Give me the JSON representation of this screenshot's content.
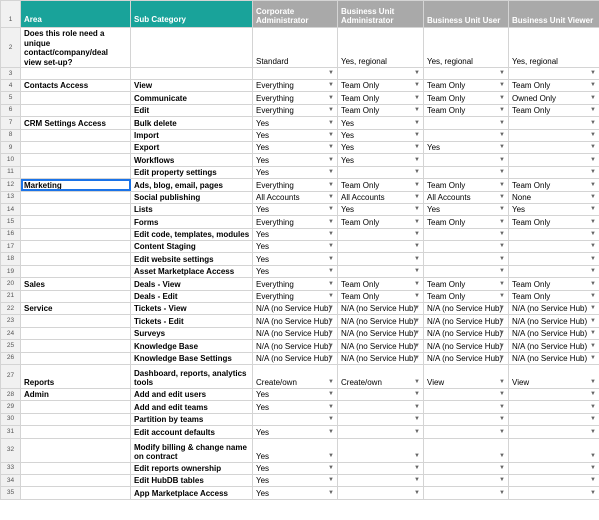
{
  "headers": {
    "area": "Area",
    "sub": "Sub Category",
    "c1": "Corporate Administrator",
    "c2": "Business Unit Administrator",
    "c3": "Business Unit User",
    "c4": "Business Unit Viewer"
  },
  "arrow": "▼",
  "rows": [
    {
      "n": "2",
      "area": "Does this role need a unique contact/company/deal view set-up?",
      "sub": "",
      "v": [
        "Standard",
        "Yes, regional",
        "Yes, regional",
        "Yes, regional"
      ],
      "dd": [
        false,
        false,
        false,
        false
      ]
    },
    {
      "n": "3",
      "area": "",
      "sub": "",
      "v": [
        "",
        "",
        "",
        ""
      ],
      "dd": [
        true,
        true,
        true,
        true
      ]
    },
    {
      "n": "4",
      "area": "Contacts Access",
      "sub": "View",
      "v": [
        "Everything",
        "Team Only",
        "Team Only",
        "Team Only"
      ],
      "dd": [
        true,
        true,
        true,
        true
      ]
    },
    {
      "n": "5",
      "area": "",
      "sub": "Communicate",
      "v": [
        "Everything",
        "Team Only",
        "Team Only",
        "Owned Only"
      ],
      "dd": [
        true,
        true,
        true,
        true
      ]
    },
    {
      "n": "6",
      "area": "",
      "sub": "Edit",
      "v": [
        "Everything",
        "Team Only",
        "Team Only",
        "Team Only"
      ],
      "dd": [
        true,
        true,
        true,
        true
      ]
    },
    {
      "n": "7",
      "area": "CRM Settings Access",
      "sub": "Bulk delete",
      "v": [
        "Yes",
        "Yes",
        "",
        ""
      ],
      "dd": [
        true,
        true,
        true,
        true
      ]
    },
    {
      "n": "8",
      "area": "",
      "sub": "Import",
      "v": [
        "Yes",
        "Yes",
        "",
        ""
      ],
      "dd": [
        true,
        true,
        true,
        true
      ]
    },
    {
      "n": "9",
      "area": "",
      "sub": "Export",
      "v": [
        "Yes",
        "Yes",
        "Yes",
        ""
      ],
      "dd": [
        true,
        true,
        true,
        true
      ]
    },
    {
      "n": "10",
      "area": "",
      "sub": "Workflows",
      "v": [
        "Yes",
        "Yes",
        "",
        ""
      ],
      "dd": [
        true,
        true,
        true,
        true
      ]
    },
    {
      "n": "11",
      "area": "",
      "sub": "Edit property settings",
      "v": [
        "Yes",
        "",
        "",
        ""
      ],
      "dd": [
        true,
        true,
        true,
        true
      ]
    },
    {
      "n": "12",
      "area": "Marketing",
      "sub": "Ads, blog, email, pages",
      "v": [
        "Everything",
        "Team Only",
        "Team Only",
        "Team Only"
      ],
      "dd": [
        true,
        true,
        true,
        true
      ],
      "sel": true
    },
    {
      "n": "13",
      "area": "",
      "sub": "Social publishing",
      "v": [
        "All Accounts",
        "All Accounts",
        "All Accounts",
        "None"
      ],
      "dd": [
        true,
        true,
        true,
        true
      ]
    },
    {
      "n": "14",
      "area": "",
      "sub": "Lists",
      "v": [
        "Yes",
        "Yes",
        "Yes",
        "Yes"
      ],
      "dd": [
        true,
        true,
        true,
        true
      ]
    },
    {
      "n": "15",
      "area": "",
      "sub": "Forms",
      "v": [
        "Everything",
        "Team Only",
        "Team Only",
        "Team Only"
      ],
      "dd": [
        true,
        true,
        true,
        true
      ]
    },
    {
      "n": "16",
      "area": "",
      "sub": "Edit code, templates, modules",
      "v": [
        "Yes",
        "",
        "",
        ""
      ],
      "dd": [
        true,
        true,
        true,
        true
      ]
    },
    {
      "n": "17",
      "area": "",
      "sub": "Content Staging",
      "v": [
        "Yes",
        "",
        "",
        ""
      ],
      "dd": [
        true,
        true,
        true,
        true
      ]
    },
    {
      "n": "18",
      "area": "",
      "sub": "Edit website settings",
      "v": [
        "Yes",
        "",
        "",
        ""
      ],
      "dd": [
        true,
        true,
        true,
        true
      ]
    },
    {
      "n": "19",
      "area": "",
      "sub": "Asset Marketplace Access",
      "v": [
        "Yes",
        "",
        "",
        ""
      ],
      "dd": [
        true,
        true,
        true,
        true
      ]
    },
    {
      "n": "20",
      "area": "Sales",
      "sub": "Deals - View",
      "v": [
        "Everything",
        "Team Only",
        "Team Only",
        "Team Only"
      ],
      "dd": [
        true,
        true,
        true,
        true
      ]
    },
    {
      "n": "21",
      "area": "",
      "sub": "Deals - Edit",
      "v": [
        "Everything",
        "Team Only",
        "Team Only",
        "Team Only"
      ],
      "dd": [
        true,
        true,
        true,
        true
      ]
    },
    {
      "n": "22",
      "area": "Service",
      "sub": "Tickets - View",
      "v": [
        "N/A (no Service Hub)",
        "N/A (no Service Hub)",
        "N/A (no Service Hub)",
        "N/A (no Service Hub)"
      ],
      "dd": [
        true,
        true,
        true,
        true
      ]
    },
    {
      "n": "23",
      "area": "",
      "sub": "Tickets - Edit",
      "v": [
        "N/A (no Service Hub)",
        "N/A (no Service Hub)",
        "N/A (no Service Hub)",
        "N/A (no Service Hub)"
      ],
      "dd": [
        true,
        true,
        true,
        true
      ]
    },
    {
      "n": "24",
      "area": "",
      "sub": "Surveys",
      "v": [
        "N/A (no Service Hub)",
        "N/A (no Service Hub)",
        "N/A (no Service Hub)",
        "N/A (no Service Hub)"
      ],
      "dd": [
        true,
        true,
        true,
        true
      ]
    },
    {
      "n": "25",
      "area": "",
      "sub": "Knowledge Base",
      "v": [
        "N/A (no Service Hub)",
        "N/A (no Service Hub)",
        "N/A (no Service Hub)",
        "N/A (no Service Hub)"
      ],
      "dd": [
        true,
        true,
        true,
        true
      ]
    },
    {
      "n": "26",
      "area": "",
      "sub": "Knowledge Base Settings",
      "v": [
        "N/A (no Service Hub)",
        "N/A (no Service Hub)",
        "N/A (no Service Hub)",
        "N/A (no Service Hub)"
      ],
      "dd": [
        true,
        true,
        true,
        true
      ]
    },
    {
      "n": "27",
      "area": "Reports",
      "sub": "Dashboard, reports, analytics tools",
      "v": [
        "Create/own",
        "Create/own",
        "View",
        "View"
      ],
      "dd": [
        true,
        true,
        true,
        true
      ],
      "tall": true
    },
    {
      "n": "28",
      "area": "Admin",
      "sub": "Add and edit users",
      "v": [
        "Yes",
        "",
        "",
        ""
      ],
      "dd": [
        true,
        true,
        true,
        true
      ]
    },
    {
      "n": "29",
      "area": "",
      "sub": "Add and edit teams",
      "v": [
        "Yes",
        "",
        "",
        ""
      ],
      "dd": [
        true,
        true,
        true,
        true
      ]
    },
    {
      "n": "30",
      "area": "",
      "sub": "Partition by teams",
      "v": [
        "",
        "",
        "",
        ""
      ],
      "dd": [
        true,
        true,
        true,
        true
      ]
    },
    {
      "n": "31",
      "area": "",
      "sub": "Edit account defaults",
      "v": [
        "Yes",
        "",
        "",
        ""
      ],
      "dd": [
        true,
        true,
        true,
        true
      ]
    },
    {
      "n": "32",
      "area": "",
      "sub": "Modify billing & change name on contract",
      "v": [
        "Yes",
        "",
        "",
        ""
      ],
      "dd": [
        true,
        true,
        true,
        true
      ],
      "tall": true
    },
    {
      "n": "33",
      "area": "",
      "sub": "Edit reports ownership",
      "v": [
        "Yes",
        "",
        "",
        ""
      ],
      "dd": [
        true,
        true,
        true,
        true
      ]
    },
    {
      "n": "34",
      "area": "",
      "sub": "Edit HubDB tables",
      "v": [
        "Yes",
        "",
        "",
        ""
      ],
      "dd": [
        true,
        true,
        true,
        true
      ]
    },
    {
      "n": "35",
      "area": "",
      "sub": "App Marketplace Access",
      "v": [
        "Yes",
        "",
        "",
        ""
      ],
      "dd": [
        true,
        true,
        true,
        true
      ]
    }
  ],
  "colors": {
    "teal": "#19a39a",
    "grey": "#a9a9a9",
    "selection": "#1a73e8"
  }
}
